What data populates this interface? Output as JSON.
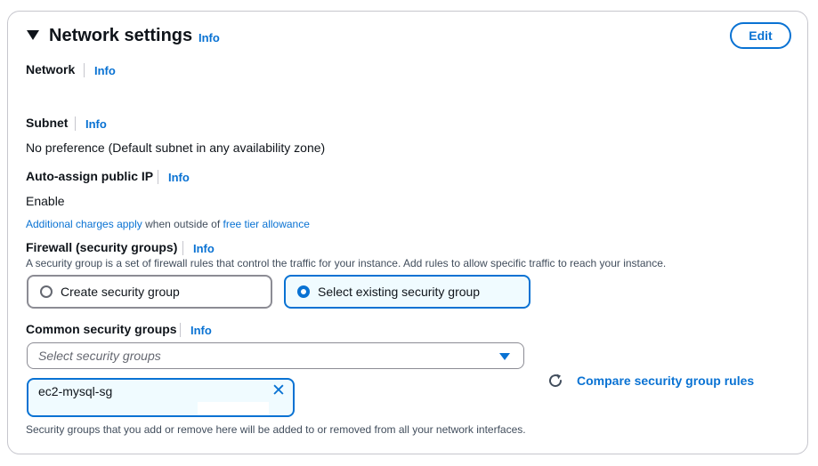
{
  "section": {
    "title": "Network settings",
    "title_info": "Info",
    "edit_label": "Edit",
    "collapse_icon": "caret-down-icon"
  },
  "network": {
    "label": "Network",
    "info": "Info"
  },
  "subnet": {
    "label": "Subnet",
    "info": "Info",
    "value": "No preference (Default subnet in any availability zone)"
  },
  "public_ip": {
    "label": "Auto-assign public IP",
    "info": "Info",
    "value": "Enable",
    "note_link1": "Additional charges apply",
    "note_middle": " when outside of ",
    "note_link2": "free tier allowance"
  },
  "firewall": {
    "label": "Firewall (security groups)",
    "info": "Info",
    "description": "A security group is a set of firewall rules that control the traffic for your instance. Add rules to allow specific traffic to reach your instance.",
    "options": [
      {
        "label": "Create security group",
        "selected": false
      },
      {
        "label": "Select existing security group",
        "selected": true
      }
    ]
  },
  "common_groups": {
    "label": "Common security groups",
    "info": "Info",
    "placeholder": "Select security groups",
    "selected_token": "ec2-mysql-sg",
    "compare_label": "Compare security group rules",
    "footer": "Security groups that you add or remove here will be added to or removed from all your network interfaces."
  },
  "colors": {
    "accent": "#0972d3",
    "text": "#0f141a",
    "border": "#c6c6cd"
  }
}
